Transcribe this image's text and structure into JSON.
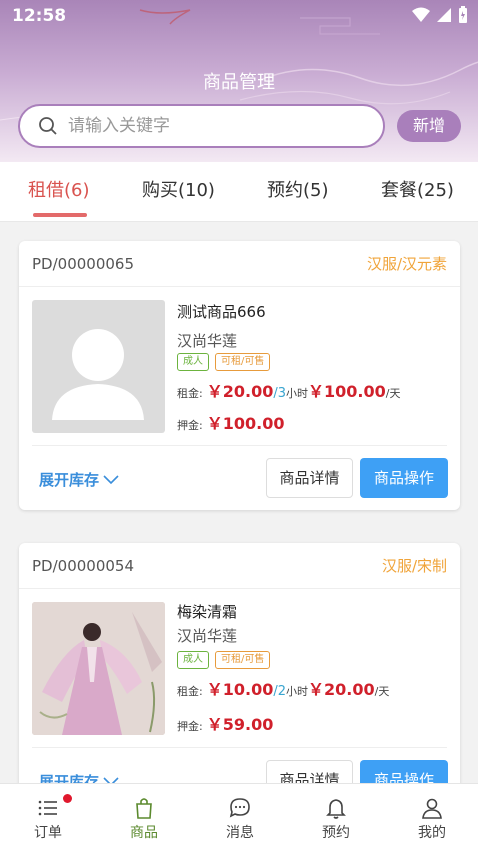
{
  "status": {
    "time": "12:58"
  },
  "header": {
    "title": "商品管理"
  },
  "search": {
    "placeholder": "请输入关键字",
    "add_label": "新增"
  },
  "tabs": [
    {
      "label": "租借(6)",
      "active": true
    },
    {
      "label": "购买(10)"
    },
    {
      "label": "预约(5)"
    },
    {
      "label": "套餐(25)"
    }
  ],
  "products": [
    {
      "code": "PD/00000065",
      "category": "汉服/汉元素",
      "name": "测试商品666",
      "brand": "汉尚华莲",
      "tags": [
        "成人",
        "可租/可售"
      ],
      "rent_label": "租金:",
      "rent_price": "￥20.00",
      "rent_period_sep": "/3",
      "rent_period_unit": "小时",
      "day_price": "￥100.00",
      "day_unit": "/天",
      "deposit_label": "押金:",
      "deposit": "￥100.00",
      "expand_label": "展开库存",
      "detail_label": "商品详情",
      "op_label": "商品操作",
      "image": "placeholder-avatar"
    },
    {
      "code": "PD/00000054",
      "category": "汉服/宋制",
      "name": "梅染清霜",
      "brand": "汉尚华莲",
      "tags": [
        "成人",
        "可租/可售"
      ],
      "rent_label": "租金:",
      "rent_price": "￥10.00",
      "rent_period_sep": "/2",
      "rent_period_unit": "小时",
      "day_price": "￥20.00",
      "day_unit": "/天",
      "deposit_label": "押金:",
      "deposit": "￥59.00",
      "expand_label": "展开库存",
      "detail_label": "商品详情",
      "op_label": "商品操作",
      "image": "hanfu-photo"
    }
  ],
  "nav": [
    {
      "label": "订单",
      "icon": "list-icon",
      "badge": true
    },
    {
      "label": "商品",
      "icon": "bag-icon",
      "active": true
    },
    {
      "label": "消息",
      "icon": "chat-icon"
    },
    {
      "label": "预约",
      "icon": "bell-icon"
    },
    {
      "label": "我的",
      "icon": "user-icon"
    }
  ],
  "colors": {
    "accent": "#a97fbb",
    "price": "#d0202b",
    "primary_button": "#3ea0f5",
    "category": "#f0a43a",
    "active_tab": "#d9534f"
  }
}
